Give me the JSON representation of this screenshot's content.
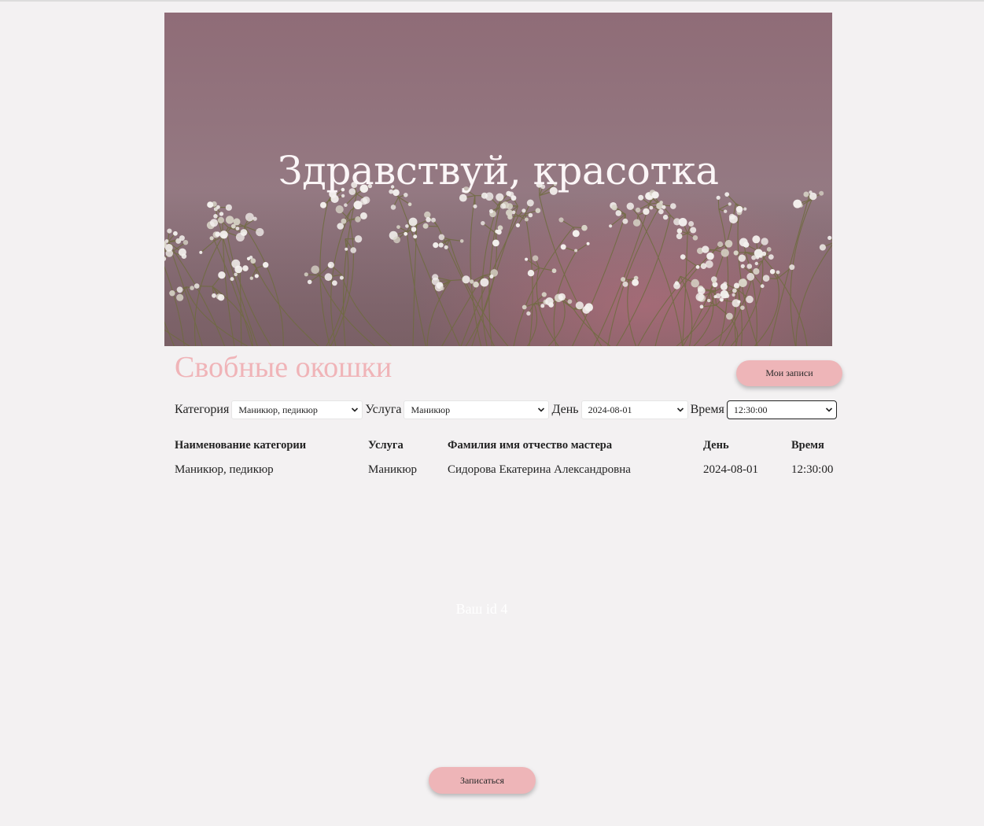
{
  "hero": {
    "title": "Здравствуй, красотка"
  },
  "header": {
    "section_title": "Свобные окошки",
    "my_records_label": "Мои записи"
  },
  "filters": {
    "category_label": "Категория",
    "category_value": "Маникюр, педикюр",
    "service_label": "Услуга",
    "service_value": "Маникюр",
    "day_label": "День",
    "day_value": "2024-08-01",
    "time_label": "Время",
    "time_value": "12:30:00"
  },
  "table": {
    "columns": [
      "Наименование категории",
      "Услуга",
      "Фамилия имя отчество мастера",
      "День",
      "Время"
    ],
    "rows": [
      [
        "Маникюр, педикюр",
        "Маникюр",
        "Сидорова Екатерина Александровна",
        "2024-08-01",
        "12:30:00"
      ]
    ]
  },
  "user": {
    "id_text": "Ваш id 4"
  },
  "footer": {
    "book_label": "Записаться"
  },
  "colors": {
    "accent": "#eeb5b8",
    "title_pink": "#f0b4b8",
    "background": "#f3f1f2",
    "hero_bg": "#937480"
  },
  "icons": {
    "dropdown": "chevron-down-icon",
    "hero_image": "gypsophila-flowers-photo"
  }
}
